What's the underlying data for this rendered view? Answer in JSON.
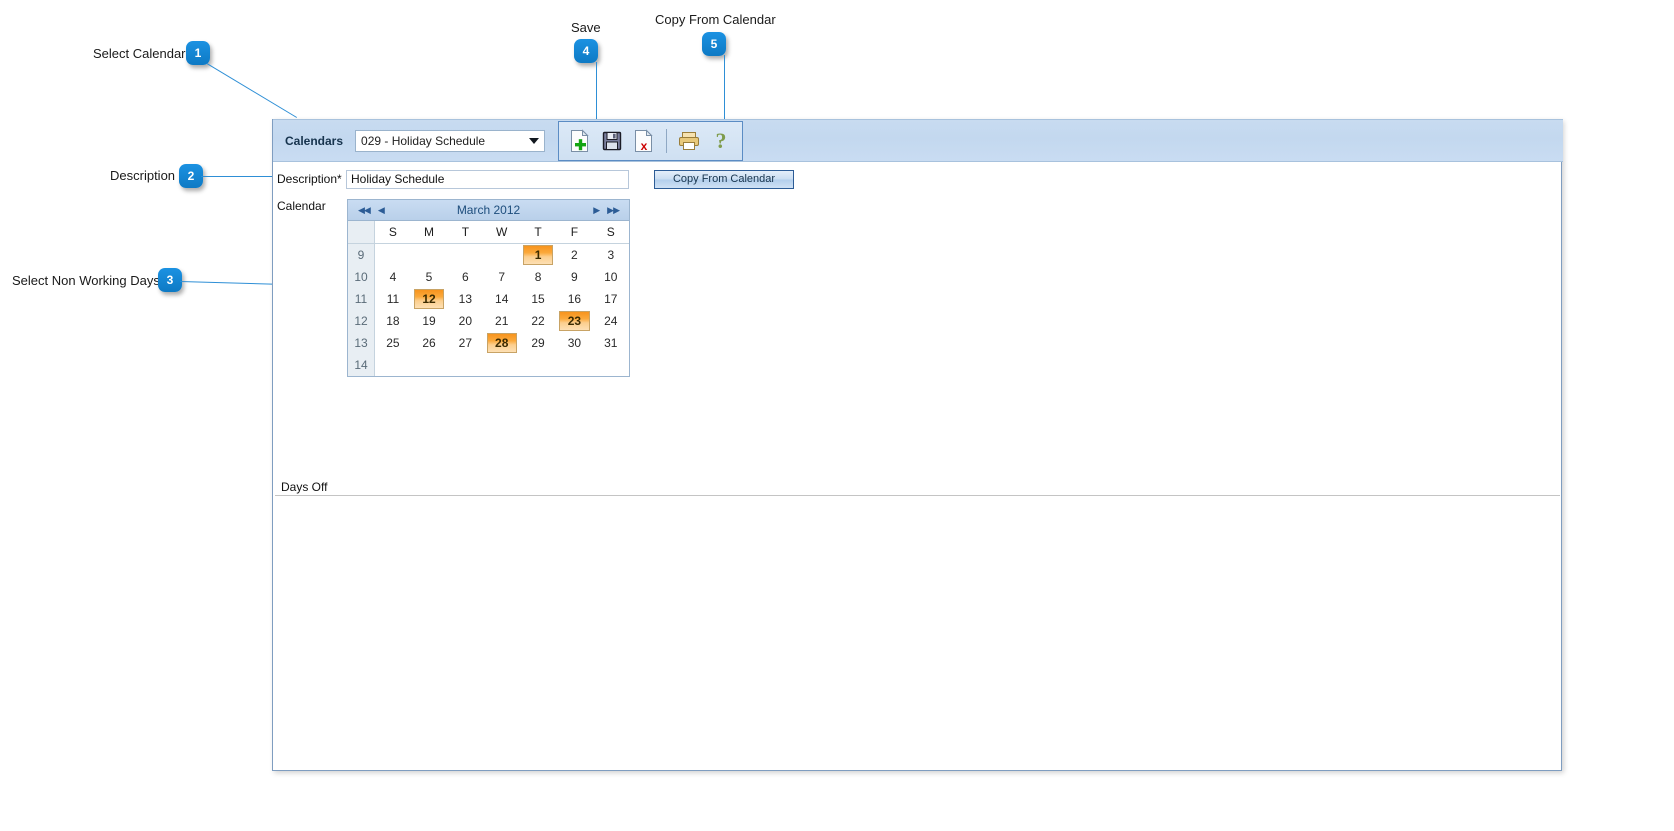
{
  "annotations": [
    {
      "id": 1,
      "number": "1",
      "label": "Select Calendar"
    },
    {
      "id": 2,
      "number": "2",
      "label": "Description"
    },
    {
      "id": 3,
      "number": "3",
      "label": "Select Non Working Days"
    },
    {
      "id": 4,
      "number": "4",
      "label": "Save"
    },
    {
      "id": 5,
      "number": "5",
      "label": "Copy From Calendar"
    }
  ],
  "header": {
    "calendars_label": "Calendars",
    "calendar_select_value": "029 - Holiday Schedule",
    "toolbar": {
      "new_icon": "new-document-icon",
      "save_icon": "save-disk-icon",
      "delete_icon": "delete-document-icon",
      "print_icon": "printer-icon",
      "help_icon": "question-mark-icon",
      "help_glyph": "?"
    }
  },
  "form": {
    "description_label": "Description*",
    "description_value": "Holiday Schedule",
    "copy_from_calendar_label": "Copy From Calendar",
    "calendar_label": "Calendar",
    "days_off_label": "Days Off"
  },
  "calendar": {
    "title": "March 2012",
    "nav": {
      "first": "◀◀",
      "prev": "◀",
      "next": "▶",
      "last": "▶▶"
    },
    "weekday_headers": [
      "S",
      "M",
      "T",
      "W",
      "T",
      "F",
      "S"
    ],
    "week_numbers": [
      "9",
      "10",
      "11",
      "12",
      "13",
      "14"
    ],
    "weeks": [
      {
        "week": "9",
        "days": [
          "",
          "",
          "",
          "",
          "1",
          "2",
          "3"
        ]
      },
      {
        "week": "10",
        "days": [
          "4",
          "5",
          "6",
          "7",
          "8",
          "9",
          "10"
        ]
      },
      {
        "week": "11",
        "days": [
          "11",
          "12",
          "13",
          "14",
          "15",
          "16",
          "17"
        ]
      },
      {
        "week": "12",
        "days": [
          "18",
          "19",
          "20",
          "21",
          "22",
          "23",
          "24"
        ]
      },
      {
        "week": "13",
        "days": [
          "25",
          "26",
          "27",
          "28",
          "29",
          "30",
          "31"
        ]
      },
      {
        "week": "14",
        "days": [
          "",
          "",
          "",
          "",
          "",
          "",
          ""
        ]
      }
    ],
    "non_working_days": [
      "1",
      "12",
      "23",
      "28"
    ]
  },
  "colors": {
    "accent_badge": "#1286d6",
    "leader_line": "#2e8fd6",
    "header_bar": "#c3d8ef",
    "non_working_day": "#f7941d",
    "calendar_title_text": "#1d4d7c"
  }
}
